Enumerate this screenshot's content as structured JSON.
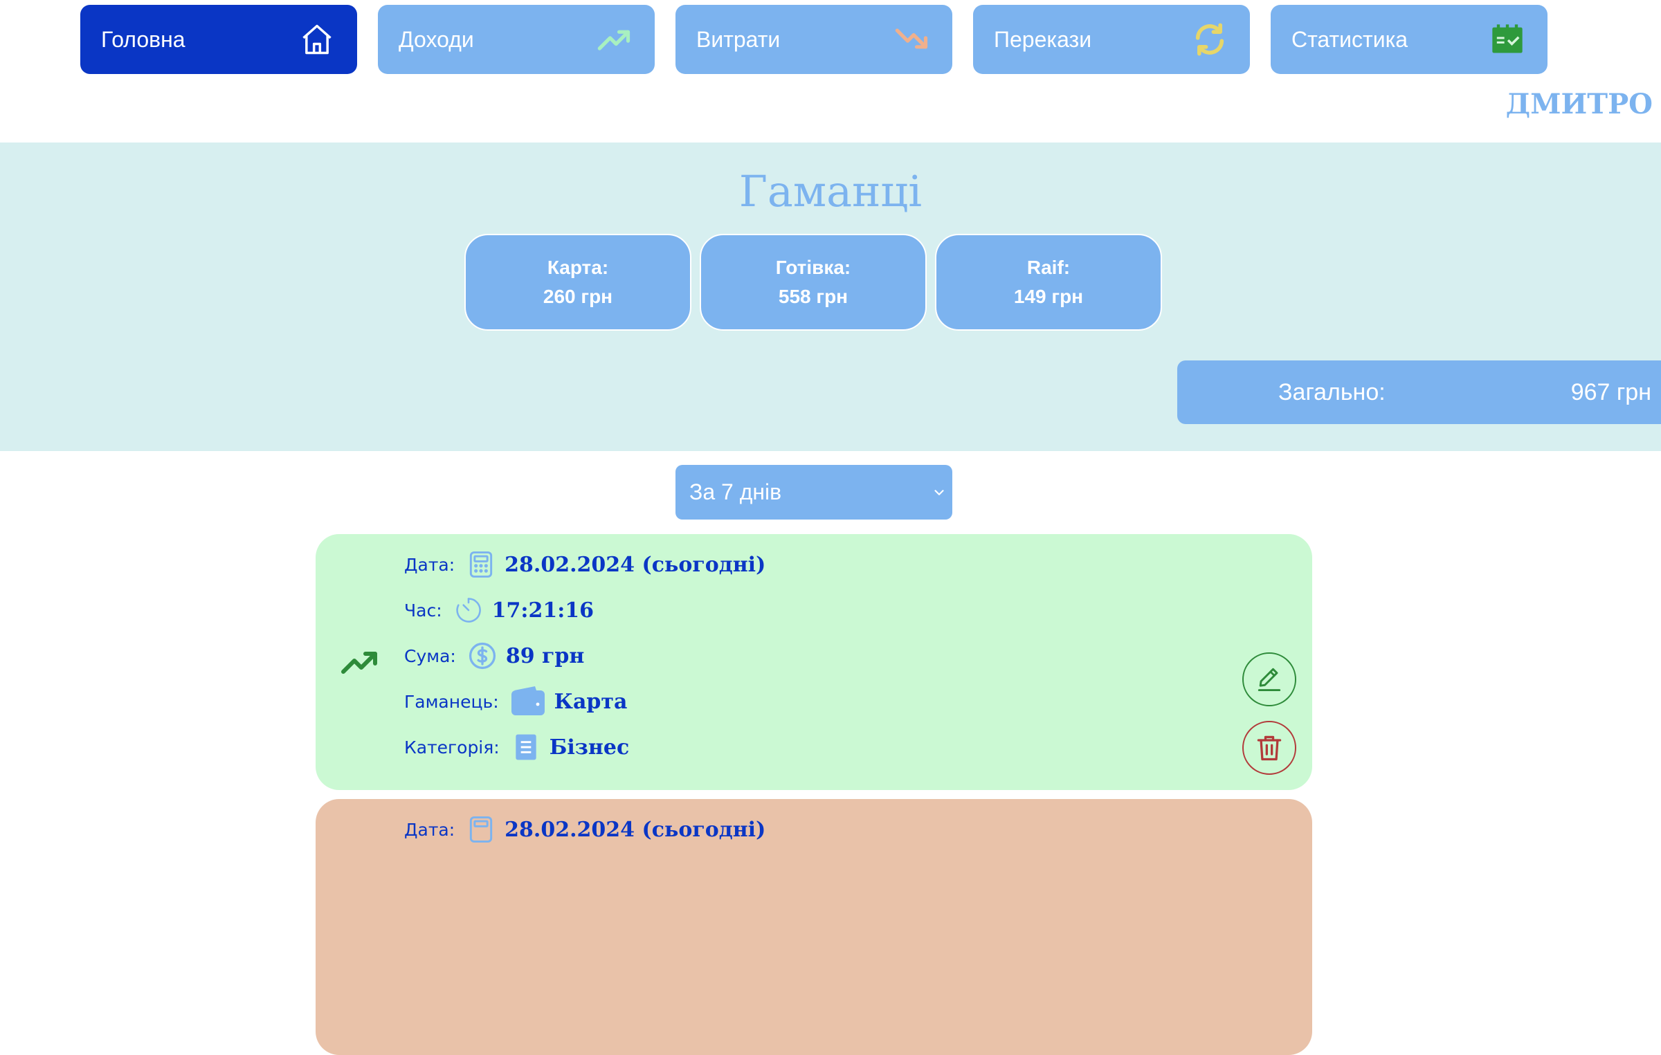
{
  "nav": {
    "items": [
      {
        "label": "Головна",
        "icon": "home-icon",
        "active": true
      },
      {
        "label": "Доходи",
        "icon": "trending-up-icon"
      },
      {
        "label": "Витрати",
        "icon": "trending-down-icon"
      },
      {
        "label": "Перекази",
        "icon": "refresh-icon"
      },
      {
        "label": "Статистика",
        "icon": "calendar-check-icon"
      }
    ]
  },
  "user": {
    "name": "ДМИТРО"
  },
  "wallets": {
    "title": "Гаманці",
    "items": [
      {
        "name": "Карта:",
        "amount": "260 грн"
      },
      {
        "name": "Готівка:",
        "amount": "558 грн"
      },
      {
        "name": "Raif:",
        "amount": "149 грн"
      }
    ],
    "total_label": "Загально:",
    "total_value": "967 грн"
  },
  "filter": {
    "period": "За 7 днів"
  },
  "transactions": [
    {
      "type": "income",
      "date_label": "Дата:",
      "date": "28.02.2024 (сьогодні)",
      "time_label": "Час:",
      "time": "17:21:16",
      "sum_label": "Сума:",
      "sum": "89 грн",
      "wallet_label": "Гаманець:",
      "wallet": "Карта",
      "category_label": "Категорія:",
      "category": "Бізнес"
    },
    {
      "type": "expense",
      "date_label": "Дата:",
      "date": "28.02.2024 (сьогодні)"
    }
  ],
  "colors": {
    "primary": "#7cb3ef",
    "active": "#0a36c5",
    "band": "#d7eff0",
    "income_card": "#cbf9d3",
    "expense_card": "#e9c2a9",
    "income_icon": "#2e8b3a",
    "delete": "#b23a3a"
  }
}
